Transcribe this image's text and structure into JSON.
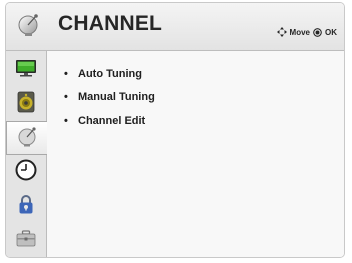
{
  "header": {
    "title": "CHANNEL",
    "hint_move": "Move",
    "hint_ok": "OK"
  },
  "sidebar": {
    "items": [
      {
        "icon": "tv-picture-icon"
      },
      {
        "icon": "speaker-audio-icon"
      },
      {
        "icon": "satellite-dish-icon",
        "selected": true
      },
      {
        "icon": "clock-icon"
      },
      {
        "icon": "lock-icon"
      },
      {
        "icon": "toolbox-icon"
      }
    ]
  },
  "menu": {
    "bullet": "•",
    "items": [
      {
        "label": "Auto Tuning"
      },
      {
        "label": "Manual Tuning"
      },
      {
        "label": "Channel Edit"
      }
    ]
  },
  "colors": {
    "accent_green": "#3fae2a",
    "text": "#202020"
  }
}
